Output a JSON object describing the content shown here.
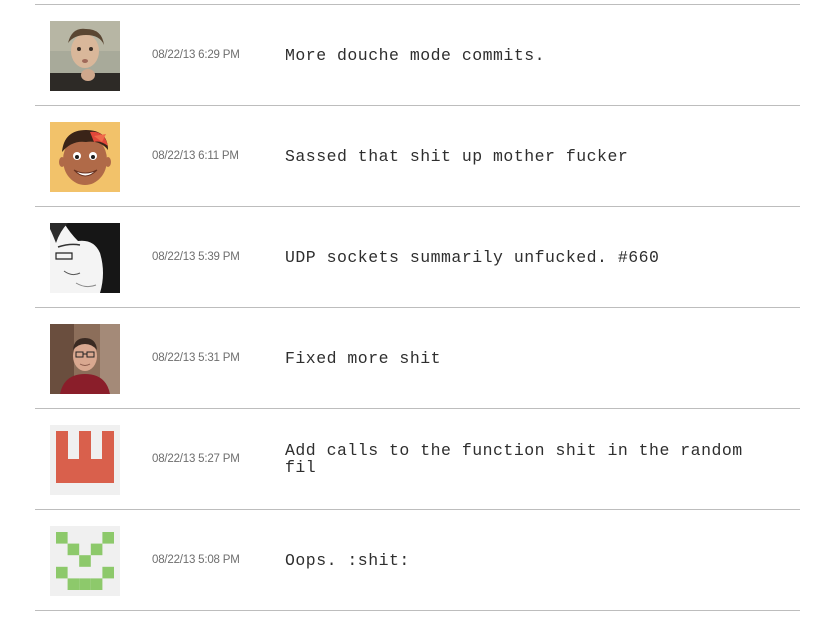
{
  "commits": [
    {
      "avatar": "user-avatar-photo-curly-hair",
      "timestamp": "08/22/13 6:29 PM",
      "message": "More douche mode commits."
    },
    {
      "avatar": "user-avatar-cartoon-face",
      "timestamp": "08/22/13 6:11 PM",
      "message": "Sassed that shit up mother fucker"
    },
    {
      "avatar": "user-avatar-sketch-face",
      "timestamp": "08/22/13 5:39 PM",
      "message": "UDP sockets summarily unfucked. #660"
    },
    {
      "avatar": "user-avatar-photo-glasses",
      "timestamp": "08/22/13 5:31 PM",
      "message": "Fixed more shit"
    },
    {
      "avatar": "identicon-red",
      "timestamp": "08/22/13 5:27 PM",
      "message": "Add calls to the function shit in the random\nfil"
    },
    {
      "avatar": "identicon-green",
      "timestamp": "08/22/13 5:08 PM",
      "message": "Oops. :shit:"
    }
  ],
  "colors": {
    "divider": "#bdbdbd",
    "timestamp_text": "#6e6e6e",
    "message_text": "#2e2e2e",
    "identicon_red": "#d9604c",
    "identicon_green": "#8dc96b",
    "identicon_bg": "#f0f0f0"
  }
}
